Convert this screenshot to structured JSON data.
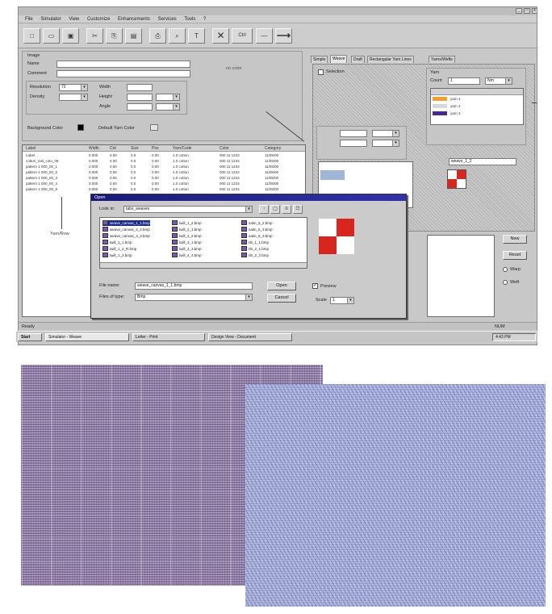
{
  "window": {
    "title_controls": [
      "_",
      "□",
      "x"
    ],
    "menu": [
      "File",
      "Simulator",
      "View",
      "Customize",
      "Enhancements",
      "Services",
      "Tools",
      "?"
    ]
  },
  "toolbar": {
    "buttons": [
      {
        "icon": "new-icon",
        "glyph": "□"
      },
      {
        "icon": "open-icon",
        "glyph": "▭"
      },
      {
        "icon": "save-icon",
        "glyph": "▣"
      },
      {
        "icon": "cut-icon",
        "glyph": "✂"
      },
      {
        "icon": "copy-icon",
        "glyph": "⎘"
      },
      {
        "icon": "paste-icon",
        "glyph": "▤"
      },
      {
        "icon": "print-icon",
        "glyph": "⎙"
      },
      {
        "icon": "find-icon",
        "glyph": "⌕"
      },
      {
        "icon": "text-icon",
        "glyph": "T"
      },
      {
        "icon": "cross-icon",
        "glyph": "✕"
      },
      {
        "icon": "line-icon",
        "glyph": "—"
      },
      {
        "icon": "arrow-icon",
        "glyph": "⟶"
      }
    ],
    "ctrl_label": "Ctrl"
  },
  "form": {
    "section": "Image",
    "name_label": "Name",
    "comment_label": "Comment",
    "resolution_label": "Resolution",
    "resolution_value": "72",
    "density_label": "Density",
    "width_label": "Width",
    "height_label": "Height",
    "angle_label": "Angle",
    "background_label": "Background Color",
    "default_label": "Default Yarn Color",
    "status_center": "no color"
  },
  "table": {
    "headers": [
      "Label",
      "Width",
      "Cnt",
      "Size",
      "Pos",
      "Yarn/Code",
      "Color",
      "Category"
    ],
    "rows": [
      [
        "Label",
        "0.000",
        "0.00",
        "0.0",
        "0.00",
        "1.0 cotton",
        "000 11 1234",
        "11/05/00"
      ],
      [
        "cotton_mel_coto_08",
        "0.000",
        "0.00",
        "0.0",
        "0.00",
        "1.0 cotton",
        "000 11 1234",
        "11/05/00"
      ],
      [
        "pattern 1 000_00_1",
        "0.000",
        "0.00",
        "0.0",
        "0.00",
        "1.0 cotton",
        "000 11 1234",
        "11/05/00"
      ],
      [
        "pattern 1 000_00_2",
        "0.000",
        "0.00",
        "0.0",
        "0.00",
        "1.0 cotton",
        "000 11 1234",
        "11/05/00"
      ],
      [
        "pattern 1 000_00_3",
        "0.000",
        "0.00",
        "0.0",
        "0.00",
        "1.0 cotton",
        "000 11 1234",
        "11/05/00"
      ],
      [
        "pattern 1 000_00_4",
        "0.000",
        "0.00",
        "0.0",
        "0.00",
        "1.0 cotton",
        "000 11 1234",
        "11/05/00"
      ],
      [
        "pattern 1 000_00_5",
        "0.000",
        "0.00",
        "0.0",
        "0.00",
        "1.0 cotton",
        "000 11 1234",
        "11/05/00"
      ]
    ],
    "callout": "Yarn/Row"
  },
  "tabs": [
    "Simple",
    "Weave",
    "Draft",
    "Rectangular Yarn Lines",
    "Yarns/Wefts"
  ],
  "right_panel": {
    "checkbox_label": "Selection",
    "group_label": "Yarn",
    "count_label": "Count",
    "count_value": "1",
    "unit_value": "Nm",
    "yarn_list": [
      {
        "label": "yarn 1",
        "color": "#f0a030"
      },
      {
        "label": "yarn 2",
        "color": "#d8d8d8"
      },
      {
        "label": "yarn 3",
        "color": "#4a2a8a"
      }
    ],
    "weave_file_value": "weave_1_2",
    "new_button": "New",
    "reset_button": "Reset",
    "radio_warp": "Warp",
    "radio_weft": "Weft"
  },
  "dialog": {
    "title": "Open",
    "lookin_label": "Look in:",
    "lookin_value": "tabs_weaves",
    "files": [
      [
        "weave_canvas_1_1.bmp",
        "twill_1_2.bmp",
        "satin_5_2.bmp"
      ],
      [
        "weave_canvas_2_2.bmp",
        "twill_2_1.bmp",
        "satin_5_3.bmp"
      ],
      [
        "weave_canvas_3_3.bmp",
        "twill_2_2.bmp",
        "satin_8_3.bmp"
      ],
      [
        "twill_1_1.bmp",
        "twill_3_1.bmp",
        "rib_1_1.bmp"
      ],
      [
        "twill_1_2_R.bmp",
        "twill_3_3.bmp",
        "rib_2_1.bmp"
      ],
      [
        "twill_1_3.bmp",
        "twill_4_4.bmp",
        "rib_2_2.bmp"
      ]
    ],
    "filename_label": "File name:",
    "filename_value": "weave_canvas_1_1.bmp",
    "filetype_label": "Files of type:",
    "filetype_value": "Bmp",
    "open_button": "Open",
    "cancel_button": "Cancel",
    "preview_label": "Preview",
    "scale_label": "Scale",
    "scale_value": "1"
  },
  "status": {
    "left": "Ready",
    "right": "NUM"
  },
  "taskbar": {
    "start": "Start",
    "tasks": [
      "Simulator - Weave",
      "Letter - Print",
      "Design View - Document"
    ],
    "clock": "4:43 PM"
  }
}
